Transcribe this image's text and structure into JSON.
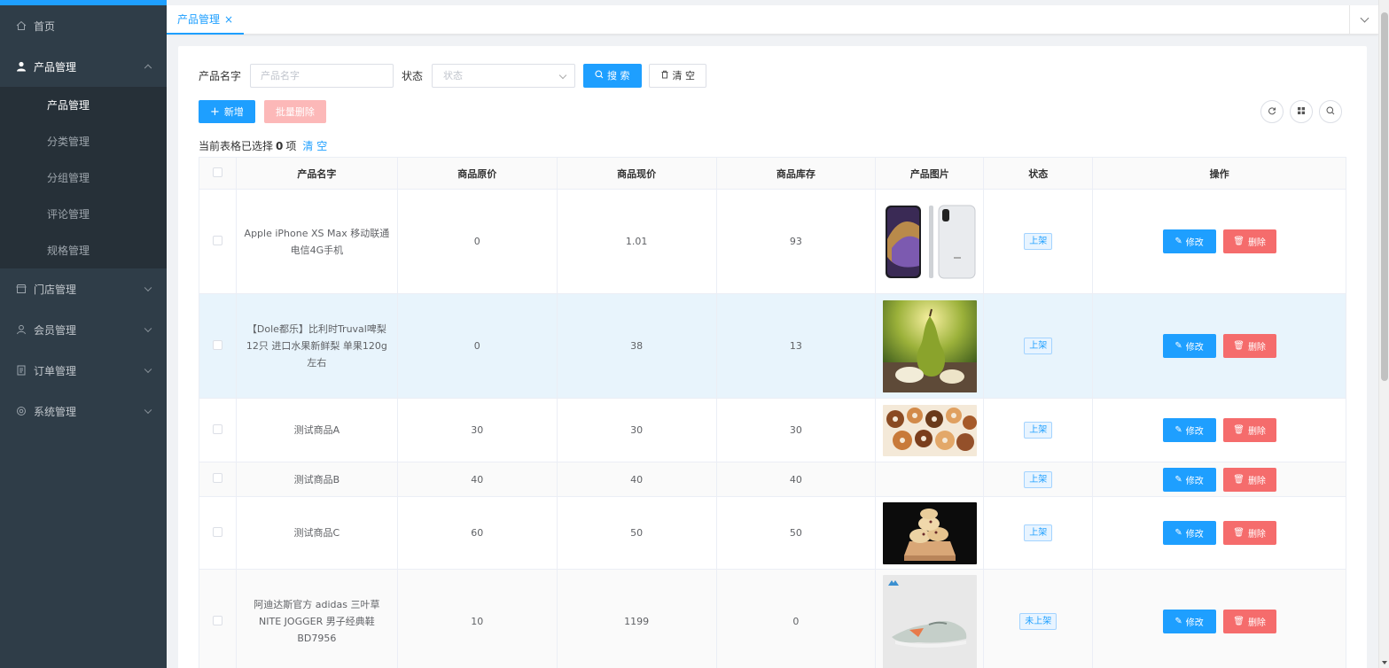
{
  "sidebar": {
    "home": "首页",
    "menus": [
      {
        "label": "产品管理",
        "icon": "user-icon",
        "expanded": true,
        "children": [
          "产品管理",
          "分类管理",
          "分组管理",
          "评论管理",
          "规格管理"
        ]
      },
      {
        "label": "门店管理",
        "icon": "store-icon"
      },
      {
        "label": "会员管理",
        "icon": "member-icon"
      },
      {
        "label": "订单管理",
        "icon": "order-icon"
      },
      {
        "label": "系统管理",
        "icon": "gear-icon"
      }
    ]
  },
  "tabs": {
    "active": "产品管理",
    "close": "×"
  },
  "search": {
    "name_label": "产品名字",
    "name_placeholder": "产品名字",
    "status_label": "状态",
    "status_placeholder": "状态",
    "search_btn": "搜 索",
    "clear_btn": "清 空"
  },
  "actions": {
    "add": "新增",
    "batch_delete": "批量删除"
  },
  "selection": {
    "prefix": "当前表格已选择",
    "count": "0",
    "suffix": "项",
    "clear": "清 空"
  },
  "table": {
    "headers": [
      "产品名字",
      "商品原价",
      "商品现价",
      "商品库存",
      "产品图片",
      "状态",
      "操作"
    ],
    "rows": [
      {
        "name": "Apple iPhone XS Max 移动联通电信4G手机",
        "orig": "0",
        "price": "1.01",
        "stock": "93",
        "image": "iphone",
        "status": "上架"
      },
      {
        "name": "【Dole都乐】比利时Truval啤梨12只 进口水果新鲜梨 单果120g左右",
        "orig": "0",
        "price": "38",
        "stock": "13",
        "image": "pear",
        "status": "上架"
      },
      {
        "name": "测试商品A",
        "orig": "30",
        "price": "30",
        "stock": "30",
        "image": "donuts",
        "status": "上架"
      },
      {
        "name": "测试商品B",
        "orig": "40",
        "price": "40",
        "stock": "40",
        "image": "",
        "status": "上架"
      },
      {
        "name": "测试商品C",
        "orig": "60",
        "price": "50",
        "stock": "50",
        "image": "cookies",
        "status": "上架"
      },
      {
        "name": "阿迪达斯官方 adidas 三叶草 NITE JOGGER 男子经典鞋BD7956",
        "orig": "10",
        "price": "1199",
        "stock": "0",
        "image": "shoe",
        "status": "未上架"
      }
    ],
    "edit": "修改",
    "delete": "删除"
  },
  "colors": {
    "primary": "#1e9fff",
    "danger": "#f56c6c",
    "sidebar": "#2f3d48"
  }
}
